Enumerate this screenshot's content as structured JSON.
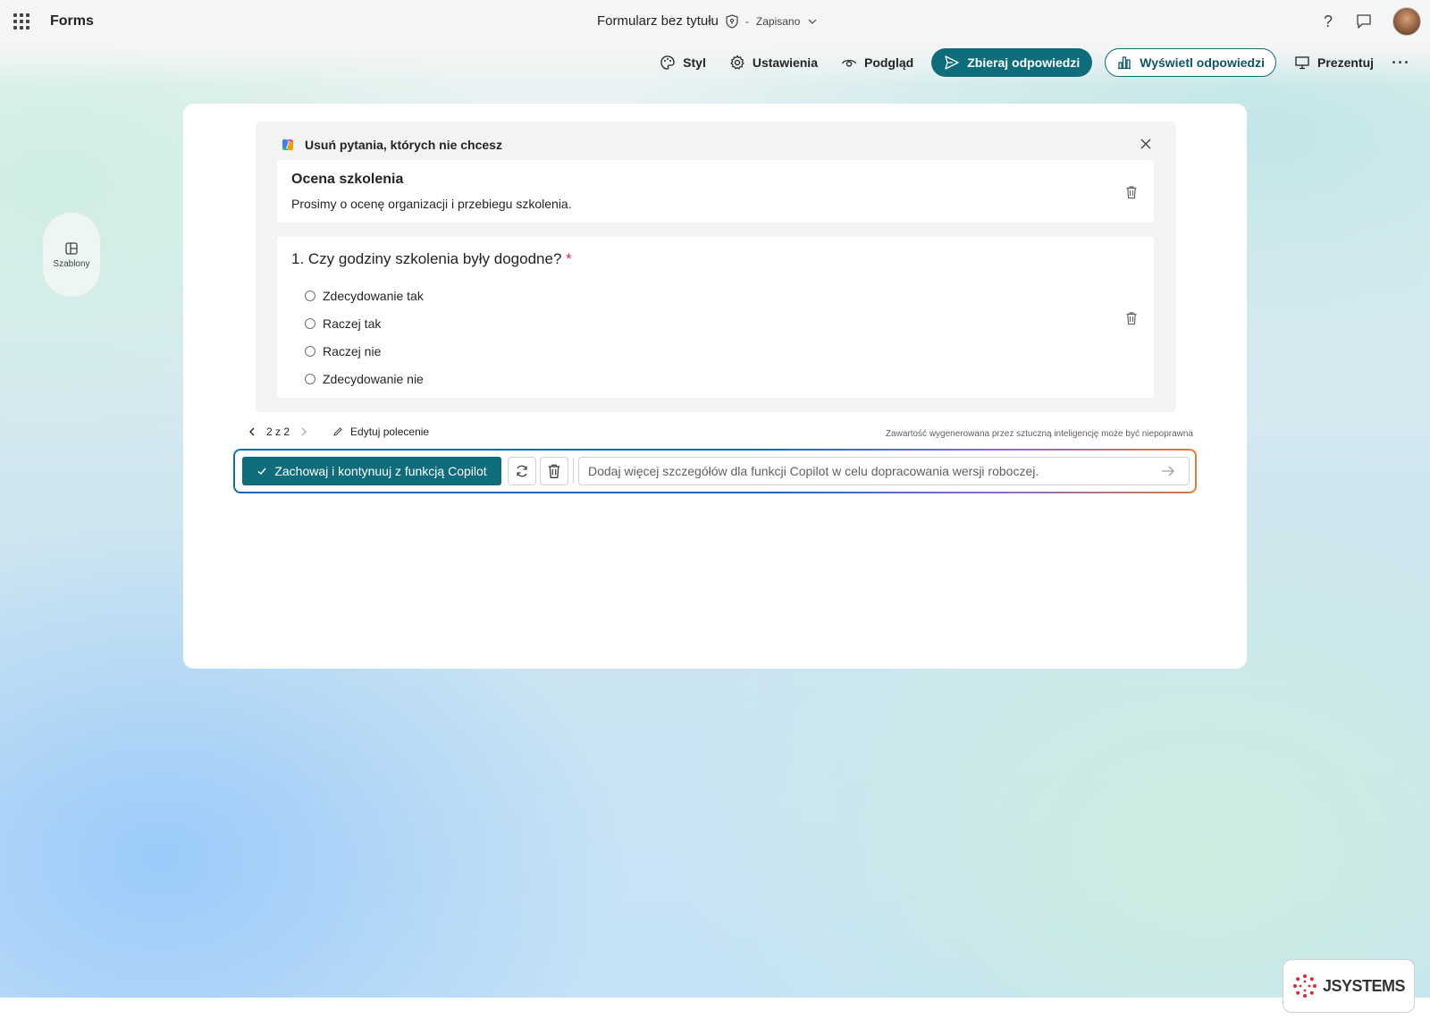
{
  "app": {
    "name": "Forms",
    "document_title": "Formularz bez tytułu",
    "separator": "-",
    "save_status": "Zapisano"
  },
  "header": {
    "help_glyph": "?"
  },
  "toolbar": {
    "style_label": "Styl",
    "settings_label": "Ustawienia",
    "preview_label": "Podgląd",
    "collect_label": "Zbieraj odpowiedzi",
    "view_responses_label": "Wyświetl odpowiedzi",
    "present_label": "Prezentuj",
    "more_glyph": "···"
  },
  "sidebar": {
    "templates_label": "Szablony"
  },
  "copilot": {
    "header": "Usuń pytania, których nie chcesz",
    "section_card": {
      "title": "Ocena szkolenia",
      "subtitle": "Prosimy o ocenę organizacji i przebiegu szkolenia."
    },
    "question": {
      "number_text": "1. Czy godziny szkolenia były dogodne?",
      "required_mark": "*",
      "options": [
        "Zdecydowanie tak",
        "Raczej tak",
        "Raczej nie",
        "Zdecydowanie nie"
      ]
    },
    "pager": "2 z 2",
    "edit_prompt_label": "Edytuj polecenie",
    "ai_disclaimer": "Zawartość wygenerowana przez sztuczną inteligencję może być niepoprawna",
    "keep_button_label": "Zachowaj i kontynuuj z funkcją Copilot",
    "input_placeholder": "Dodaj więcej szczegółów dla funkcji Copilot w celu dopracowania wersji roboczej."
  },
  "watermark": {
    "logo_text": "JSYSTEMS"
  },
  "colors": {
    "primary": "#0f6c7a",
    "required": "#c4314b"
  }
}
